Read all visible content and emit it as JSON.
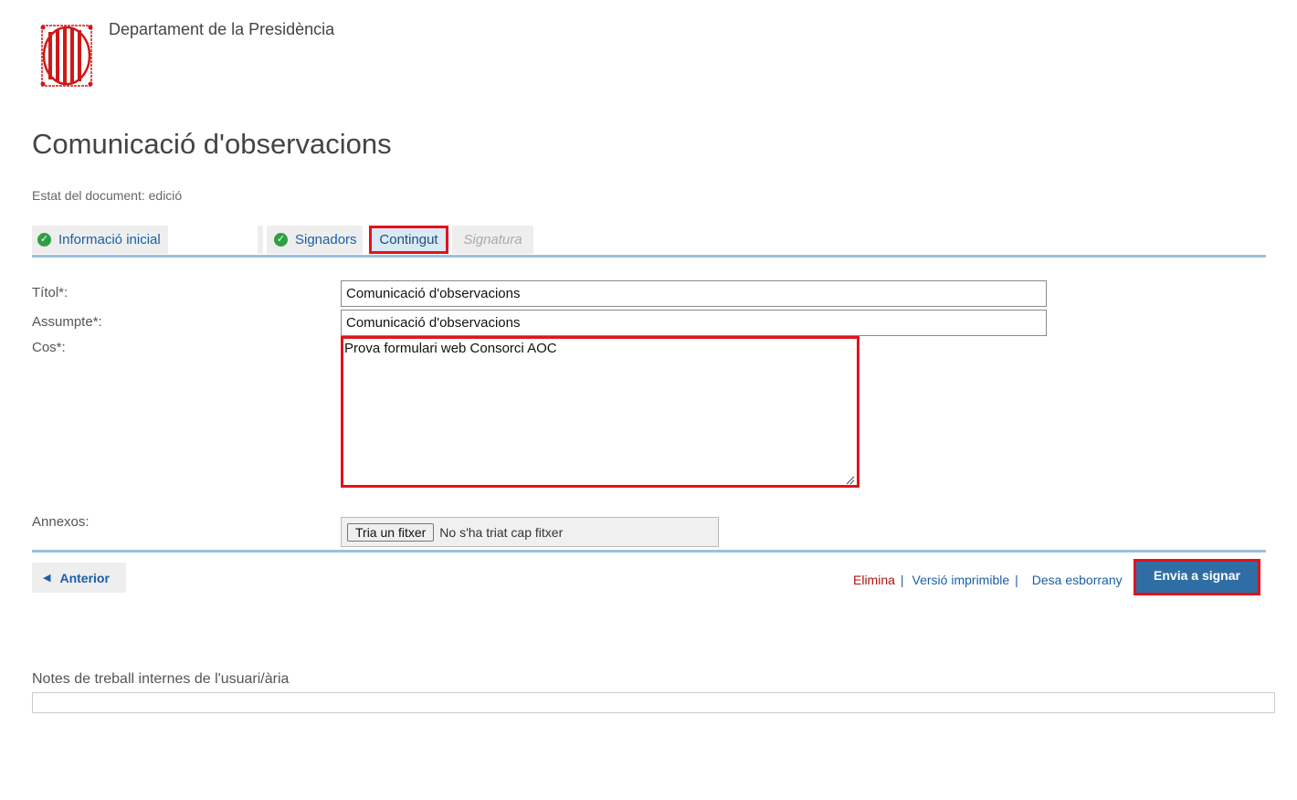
{
  "header": {
    "department": "Departament de la Presidència",
    "logo_icon": "generalitat-logo",
    "title": "Comunicació d'observacions",
    "status": "Estat del document: edició"
  },
  "tabs": [
    {
      "label": "Informació inicial",
      "state": "done"
    },
    {
      "label": "Signadors",
      "state": "done"
    },
    {
      "label": "Contingut",
      "state": "active"
    },
    {
      "label": "Signatura",
      "state": "disabled"
    }
  ],
  "form": {
    "title_label": "Títol*:",
    "title_value": "Comunicació d'observacions",
    "subject_label": "Assumpte*:",
    "subject_value": "Comunicació d'observacions",
    "body_label": "Cos*:",
    "body_value": "Prova formulari web Consorci AOC",
    "attachments_label": "Annexos:",
    "file_button": "Tria un fitxer",
    "file_status": "No s'ha triat cap fitxer"
  },
  "actions": {
    "previous": "Anterior",
    "delete": "Elimina",
    "printable": "Versió imprimible",
    "save_draft": "Desa esborrany",
    "send": "Envia a signar",
    "separator": "|"
  },
  "notes": {
    "label": "Notes de treball internes de l'usuari/ària"
  },
  "colors": {
    "accent_blue": "#2f6ea5",
    "link_blue": "#1a5ea8",
    "highlight_red": "#e3121b",
    "check_green": "#2ea043"
  }
}
